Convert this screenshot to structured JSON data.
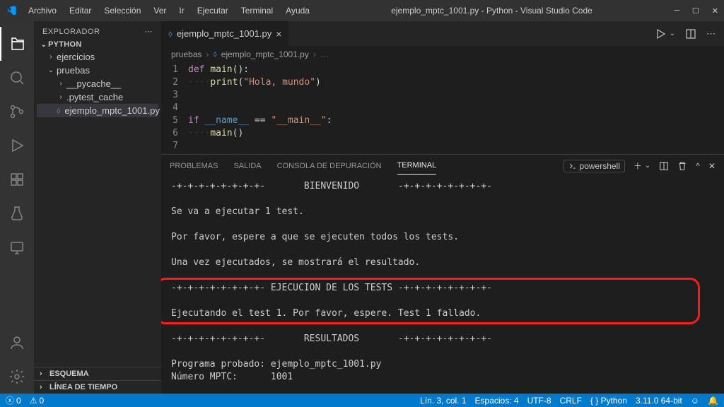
{
  "titlebar": {
    "menus": [
      "Archivo",
      "Editar",
      "Selección",
      "Ver",
      "Ir",
      "Ejecutar",
      "Terminal",
      "Ayuda"
    ],
    "title": "ejemplo_mptc_1001.py - Python - Visual Studio Code"
  },
  "sidebar": {
    "header": "EXPLORADOR",
    "root": "PYTHON",
    "tree": {
      "ejercicios": "ejercicios",
      "pruebas": "pruebas",
      "pycache": "__pycache__",
      "pytestcache": ".pytest_cache",
      "file": "ejemplo_mptc_1001.py"
    },
    "sections": {
      "esquema": "ESQUEMA",
      "timeline": "LÍNEA DE TIEMPO"
    }
  },
  "tab": {
    "label": "ejemplo_mptc_1001.py"
  },
  "breadcrumb": {
    "folder": "pruebas",
    "file": "ejemplo_mptc_1001.py"
  },
  "code": {
    "l1_def": "def",
    "l1_fn": "main",
    "l1_rest": "():",
    "l2_fn": "print",
    "l2_p1": "(",
    "l2_str": "\"Hola, mundo\"",
    "l2_p2": ")",
    "l5_if": "if",
    "l5_name": "__name__",
    "l5_eq": " == ",
    "l5_main": "\"__main__\"",
    "l5_colon": ":",
    "l6_fn": "main",
    "l6_rest": "()"
  },
  "panel": {
    "tabs": {
      "problems": "PROBLEMAS",
      "output": "SALIDA",
      "debug": "CONSOLA DE DEPURACIÓN",
      "terminal": "TERMINAL"
    },
    "shell": "powershell"
  },
  "terminal": {
    "l1": "-+-+-+-+-+-+-+-+-       BIENVENIDO       -+-+-+-+-+-+-+-+-",
    "l2": "Se va a ejecutar 1 test.",
    "l3": "Por favor, espere a que se ejecuten todos los tests.",
    "l4": "Una vez ejecutados, se mostrará el resultado.",
    "l5": "-+-+-+-+-+-+-+-+- EJECUCION DE LOS TESTS -+-+-+-+-+-+-+-+-",
    "l6": "Ejecutando el test 1. Por favor, espere. Test 1 fallado.",
    "l7": "-+-+-+-+-+-+-+-+-       RESULTADOS       -+-+-+-+-+-+-+-+-",
    "l8": "Programa probado: ejemplo_mptc_1001.py",
    "l9": "Número MPTC:      1001"
  },
  "status": {
    "errors": "0",
    "warnings": "0",
    "line": "Lín. 3, col. 1",
    "spaces": "Espacios: 4",
    "enc": "UTF-8",
    "eol": "CRLF",
    "lang": "Python",
    "ver": "3.11.0 64-bit"
  }
}
